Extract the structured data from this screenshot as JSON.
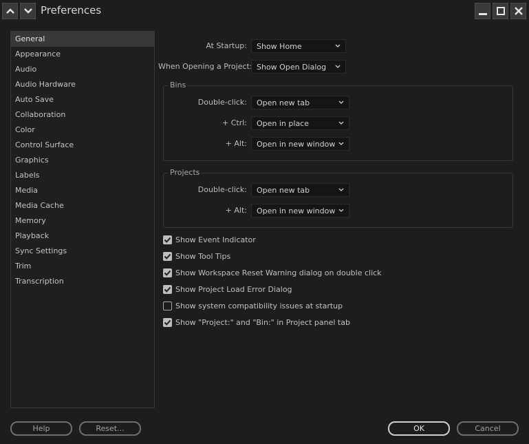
{
  "window": {
    "title": "Preferences"
  },
  "sidebar": {
    "items": [
      {
        "label": "General",
        "selected": true
      },
      {
        "label": "Appearance"
      },
      {
        "label": "Audio"
      },
      {
        "label": "Audio Hardware"
      },
      {
        "label": "Auto Save"
      },
      {
        "label": "Collaboration"
      },
      {
        "label": "Color"
      },
      {
        "label": "Control Surface"
      },
      {
        "label": "Graphics"
      },
      {
        "label": "Labels"
      },
      {
        "label": "Media"
      },
      {
        "label": "Media Cache"
      },
      {
        "label": "Memory"
      },
      {
        "label": "Playback"
      },
      {
        "label": "Sync Settings"
      },
      {
        "label": "Trim"
      },
      {
        "label": "Transcription"
      }
    ]
  },
  "general": {
    "at_startup_label": "At Startup:",
    "at_startup_value": "Show Home",
    "opening_project_label": "When Opening a Project:",
    "opening_project_value": "Show Open Dialog"
  },
  "bins": {
    "title": "Bins",
    "double_click_label": "Double-click:",
    "double_click_value": "Open new tab",
    "ctrl_label": "+ Ctrl:",
    "ctrl_value": "Open in place",
    "alt_label": "+ Alt:",
    "alt_value": "Open in new window"
  },
  "projects": {
    "title": "Projects",
    "double_click_label": "Double-click:",
    "double_click_value": "Open new tab",
    "alt_label": "+ Alt:",
    "alt_value": "Open in new window"
  },
  "checkboxes": [
    {
      "label": "Show Event Indicator",
      "checked": true
    },
    {
      "label": "Show Tool Tips",
      "checked": true
    },
    {
      "label": "Show Workspace Reset Warning dialog on double click",
      "checked": true
    },
    {
      "label": "Show Project Load Error Dialog",
      "checked": true
    },
    {
      "label": "Show system compatibility issues at startup",
      "checked": false
    },
    {
      "label": "Show \"Project:\" and \"Bin:\" in Project panel tab",
      "checked": true
    }
  ],
  "buttons": {
    "help": "Help",
    "reset": "Reset...",
    "ok": "OK",
    "cancel": "Cancel"
  }
}
